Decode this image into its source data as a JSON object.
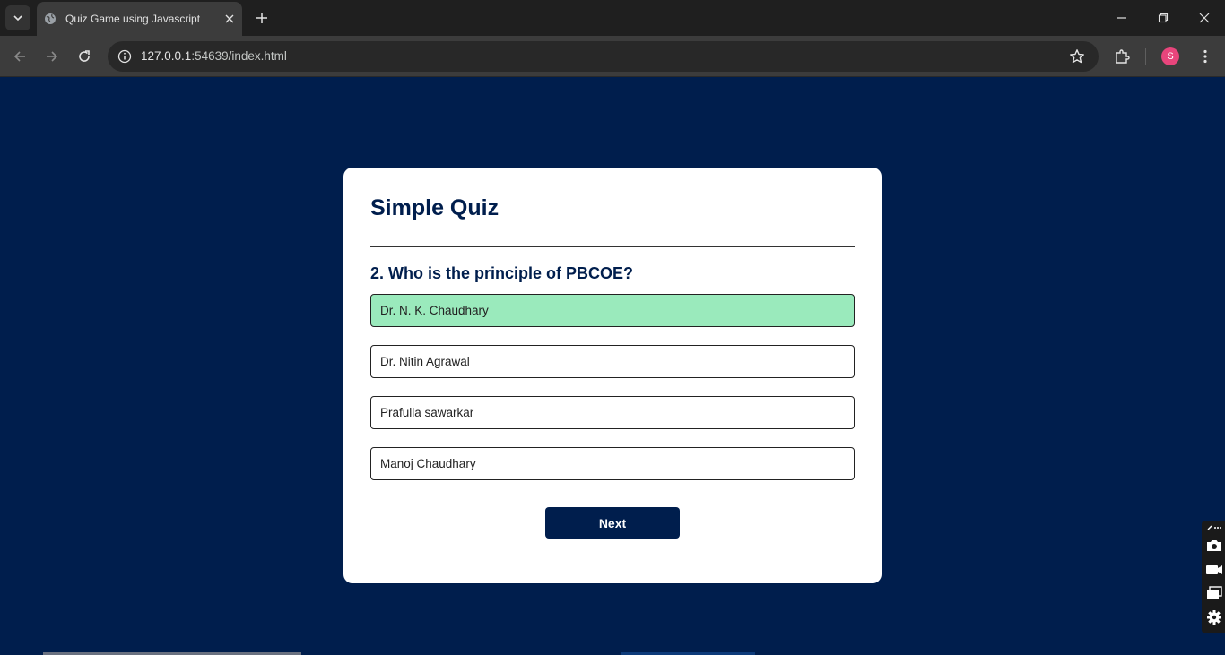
{
  "browser": {
    "tab_title": "Quiz Game using Javascript",
    "url_host": "127.0.0.1",
    "url_rest": ":54639/index.html",
    "profile_initial": "S"
  },
  "quiz": {
    "title": "Simple Quiz",
    "question": "2. Who is the principle of PBCOE?",
    "answers": [
      {
        "text": "Dr. N. K. Chaudhary",
        "state": "correct"
      },
      {
        "text": "Dr. Nitin Agrawal",
        "state": "default"
      },
      {
        "text": "Prafulla sawarkar",
        "state": "default"
      },
      {
        "text": "Manoj Chaudhary",
        "state": "default"
      }
    ],
    "next_label": "Next"
  },
  "colors": {
    "page_bg": "#001e4d",
    "card_bg": "#ffffff",
    "correct_bg": "#9aeabc",
    "primary": "#001e4d"
  }
}
